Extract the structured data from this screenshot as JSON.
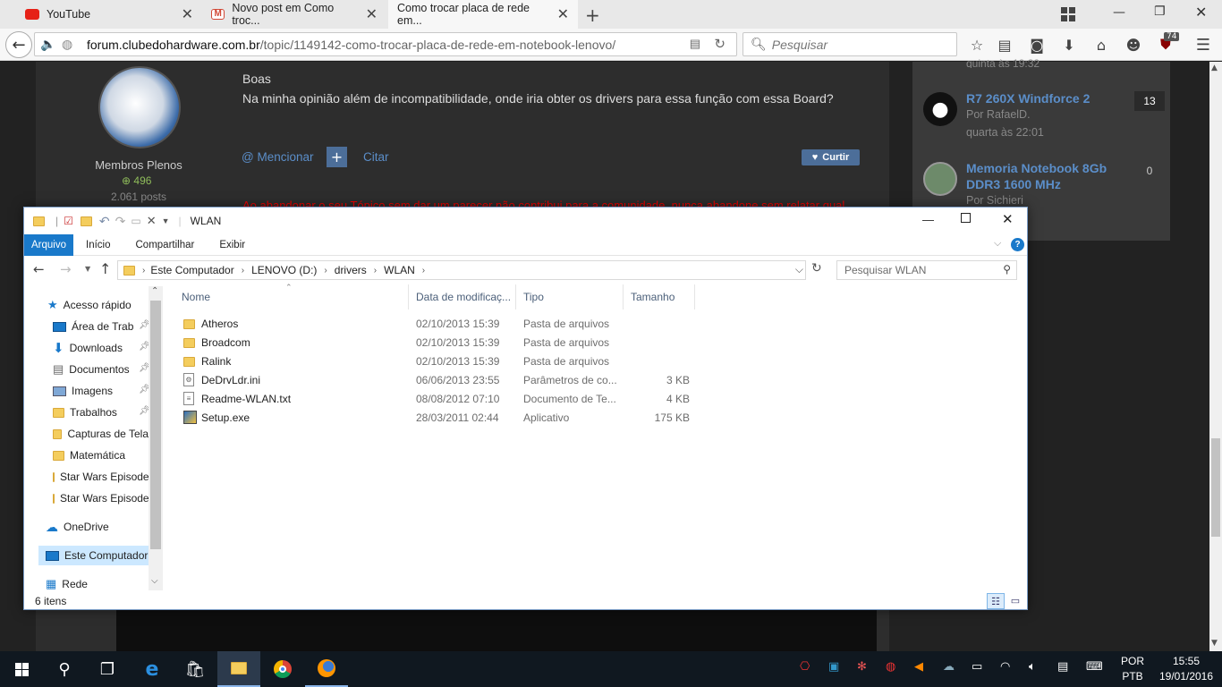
{
  "browser": {
    "tabs": [
      {
        "label": "YouTube",
        "icon": "youtube-icon",
        "color": "#e62117"
      },
      {
        "label": "Novo post em Como troc...",
        "icon": "gmail-icon",
        "color": "#d14836"
      },
      {
        "label": "Como trocar placa de rede em...",
        "icon": "",
        "color": ""
      }
    ],
    "url_host": "forum.clubedohardware.com.br",
    "url_path": "/topic/1149142-como-trocar-placa-de-rede-em-notebook-lenovo/",
    "search_placeholder": "Pesquisar",
    "ublock_badge": "74"
  },
  "web": {
    "post_greeting": "Boas",
    "post_text": "Na minha opinião além de incompatibilidade, onde iria obter os drivers para essa função com essa Board?",
    "user_group": "Membros Plenos",
    "reputation": "496",
    "post_count": "2.061 posts",
    "mention_label": "@ Mencionar",
    "quote_label": "Citar",
    "like_label": "Curtir",
    "signature_text": "Ao abandonar o seu Tópico sem dar um parecer não contribui para a comunidade, nunca abandone sem relatar qual",
    "sidebar": {
      "prev_time": "quinta às 19:32",
      "items": [
        {
          "title": "R7 260X Windforce 2",
          "author": "Por RafaelD.",
          "time": "quarta às 22:01",
          "count": "13"
        },
        {
          "title": "Memoria Notebook 8Gb DDR3 1600 MHz",
          "author": "Por Sichieri",
          "time": "",
          "count": "0"
        }
      ]
    }
  },
  "explorer": {
    "title": "WLAN",
    "ribbon_tabs": [
      "Arquivo",
      "Início",
      "Compartilhar",
      "Exibir"
    ],
    "breadcrumb": [
      "Este Computador",
      "LENOVO (D:)",
      "drivers",
      "WLAN"
    ],
    "search_placeholder": "Pesquisar WLAN",
    "nav_items": [
      {
        "label": "Acesso rápido",
        "icon": "star-icon",
        "pinned": false
      },
      {
        "label": "Área de Trabalho",
        "icon": "desktop-icon",
        "pinned": true
      },
      {
        "label": "Downloads",
        "icon": "download-icon",
        "pinned": true
      },
      {
        "label": "Documentos",
        "icon": "document-icon",
        "pinned": true
      },
      {
        "label": "Imagens",
        "icon": "image-icon",
        "pinned": true
      },
      {
        "label": "Trabalhos",
        "icon": "folder-icon",
        "pinned": true
      },
      {
        "label": "Capturas de Tela",
        "icon": "folder-icon",
        "pinned": false
      },
      {
        "label": "Matemática",
        "icon": "folder-icon",
        "pinned": false
      },
      {
        "label": "Star Wars Episode",
        "icon": "folder-icon",
        "pinned": false
      },
      {
        "label": "Star Wars Episode",
        "icon": "folder-icon",
        "pinned": false
      },
      {
        "label": "OneDrive",
        "icon": "cloud-icon",
        "pinned": false
      },
      {
        "label": "Este Computador",
        "icon": "computer-icon",
        "pinned": false
      },
      {
        "label": "Rede",
        "icon": "network-icon",
        "pinned": false
      }
    ],
    "columns": [
      "Nome",
      "Data de modificaç...",
      "Tipo",
      "Tamanho"
    ],
    "files": [
      {
        "name": "Atheros",
        "date": "02/10/2013 15:39",
        "type": "Pasta de arquivos",
        "size": "",
        "icon": "folder-icon"
      },
      {
        "name": "Broadcom",
        "date": "02/10/2013 15:39",
        "type": "Pasta de arquivos",
        "size": "",
        "icon": "folder-icon"
      },
      {
        "name": "Ralink",
        "date": "02/10/2013 15:39",
        "type": "Pasta de arquivos",
        "size": "",
        "icon": "folder-icon"
      },
      {
        "name": "DeDrvLdr.ini",
        "date": "06/06/2013 23:55",
        "type": "Parâmetros de co...",
        "size": "3 KB",
        "icon": "settings-file-icon"
      },
      {
        "name": "Readme-WLAN.txt",
        "date": "08/08/2012 07:10",
        "type": "Documento de Te...",
        "size": "4 KB",
        "icon": "text-file-icon"
      },
      {
        "name": "Setup.exe",
        "date": "28/03/2011 02:44",
        "type": "Aplicativo",
        "size": "175 KB",
        "icon": "setup-icon"
      }
    ],
    "status": "6 itens"
  },
  "taskbar": {
    "lang1": "POR",
    "lang2": "PTB",
    "time": "15:55",
    "date": "19/01/2016"
  }
}
